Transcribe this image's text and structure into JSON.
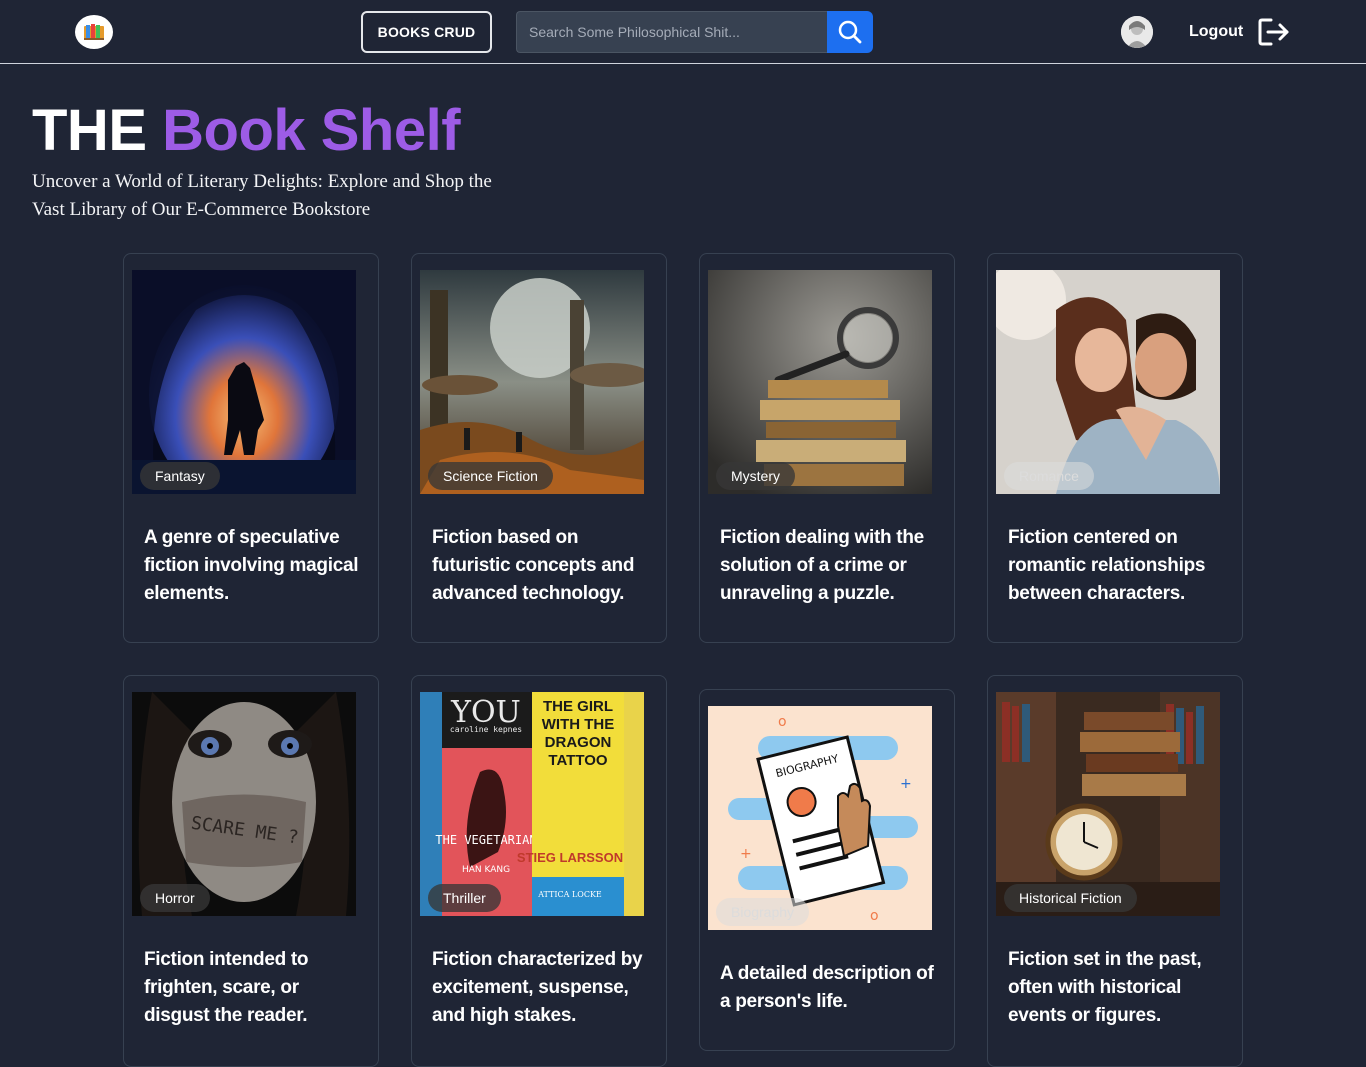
{
  "navbar": {
    "logo": "book-logo-icon",
    "crud_button": "BOOKS CRUD",
    "search": {
      "placeholder": "Search Some Philosophical Shit...",
      "value": ""
    },
    "search_icon": "search-icon",
    "avatar": "user-avatar",
    "logout_label": "Logout",
    "logout_icon": "logout-arrow-icon"
  },
  "hero": {
    "title_prefix": "THE",
    "title_accent": "Book Shelf",
    "subtitle": "Uncover a World of Literary Delights: Explore and Shop the Vast Library of Our E-Commerce Bookstore"
  },
  "colors": {
    "background": "#1f2535",
    "accent": "#9d5ce6",
    "search_button": "#1d6ff0"
  },
  "genres": [
    {
      "name": "Fantasy",
      "description": "A genre of speculative fiction involving magical elements."
    },
    {
      "name": "Science Fiction",
      "description": "Fiction based on futuristic concepts and advanced technology."
    },
    {
      "name": "Mystery",
      "description": "Fiction dealing with the solution of a crime or unraveling a puzzle."
    },
    {
      "name": "Romance",
      "description": "Fiction centered on romantic relationships between characters."
    },
    {
      "name": "Horror",
      "description": "Fiction intended to frighten, scare, or disgust the reader.",
      "image_text": "SCARE ME ?"
    },
    {
      "name": "Thriller",
      "description": "Fiction characterized by excitement, suspense, and high stakes.",
      "covers": [
        {
          "title": "YOU",
          "author": "caroline kepnes"
        },
        {
          "title": "THE VEGETARIAN",
          "author": "HAN KANG"
        },
        {
          "title": "THE GIRL WITH THE DRAGON TATTOO",
          "author": "STIEG LARSSON"
        },
        {
          "author": "ATTICA LOCKE"
        }
      ]
    },
    {
      "name": "Biography",
      "description": "A detailed description of a person's life.",
      "image_text": "BIOGRAPHY"
    },
    {
      "name": "Historical Fiction",
      "description": "Fiction set in the past, often with historical events or figures."
    }
  ]
}
